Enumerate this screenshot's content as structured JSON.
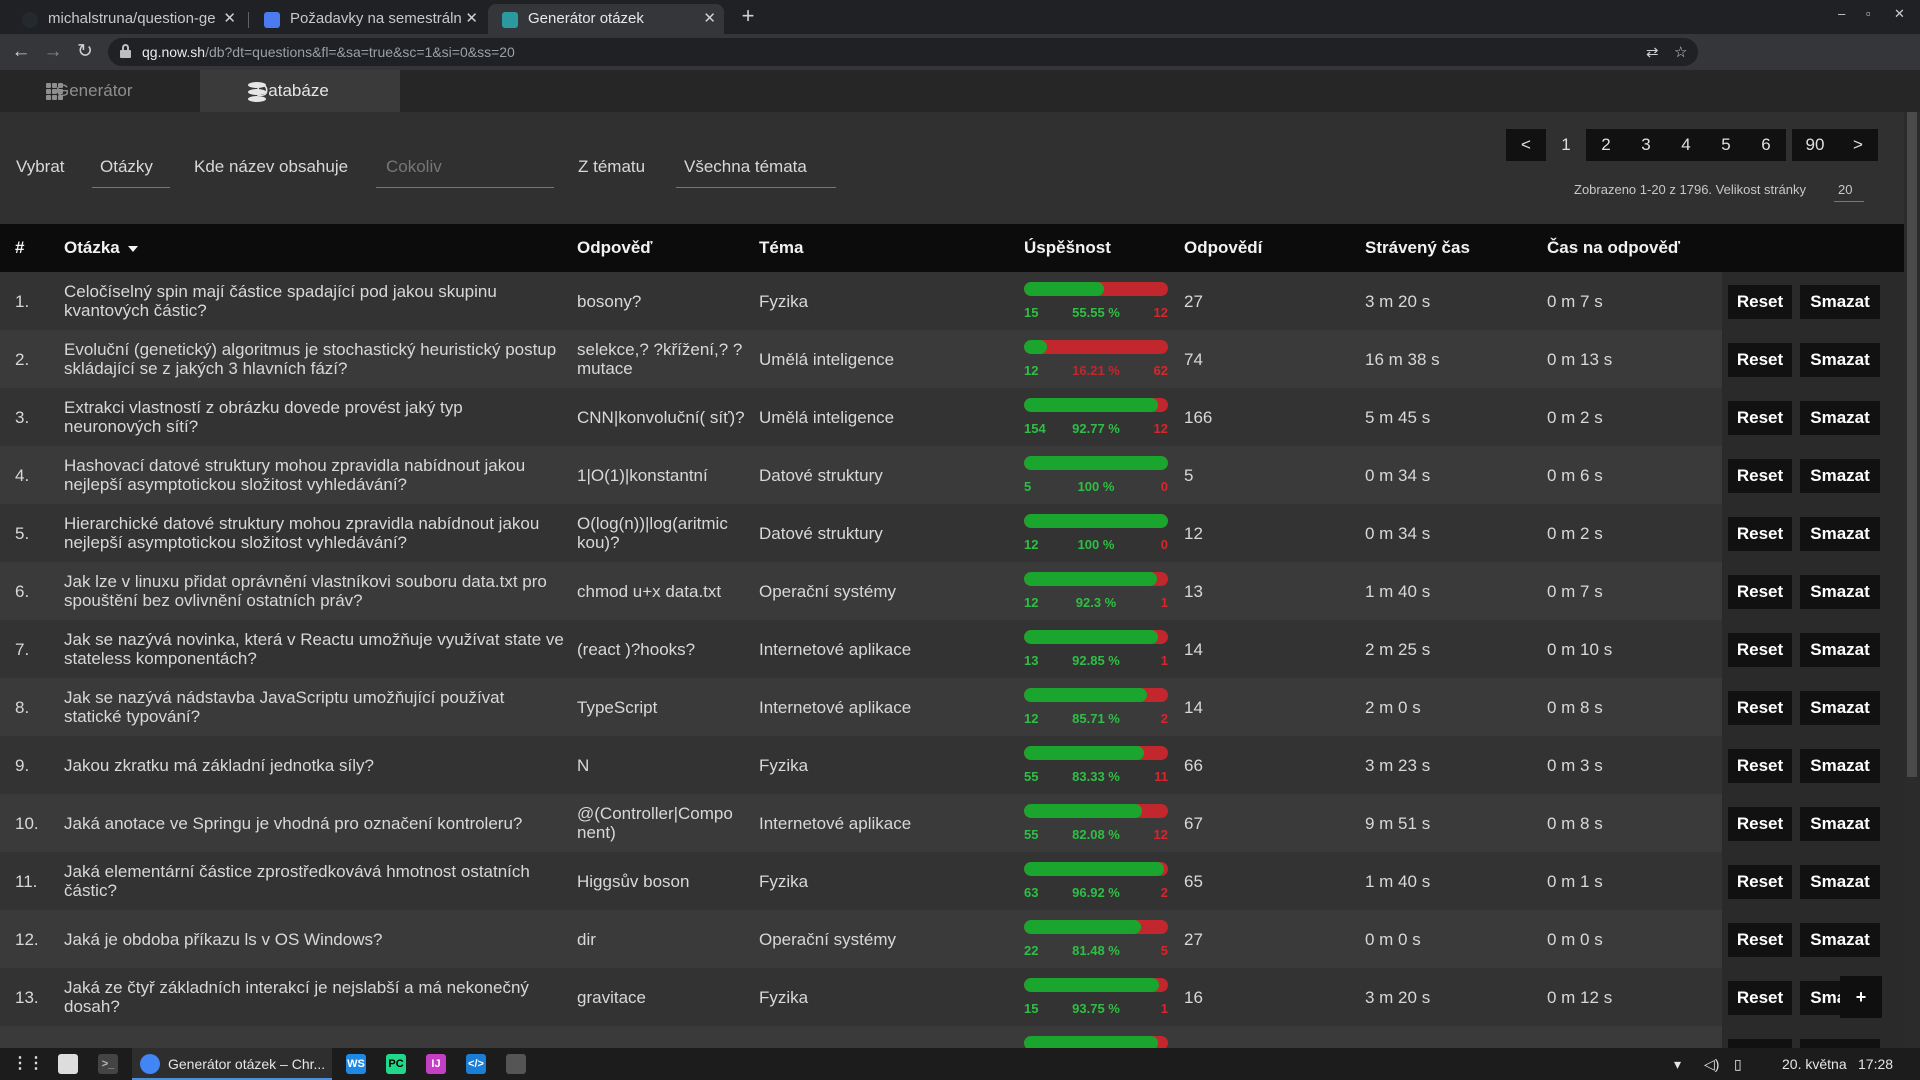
{
  "browser": {
    "tabs": [
      {
        "title": "michalstruna/question-ge",
        "icon_color": "#24292e"
      },
      {
        "title": "Požadavky na semestráln",
        "icon_color": "#4a7bf0"
      },
      {
        "title": "Generátor otázek",
        "icon_color": "#2a9aa0"
      }
    ],
    "url_host": "qg.now.sh",
    "url_path": "/db?dt=questions&fl=&sa=true&sc=1&si=0&ss=20"
  },
  "app_nav": {
    "generator_label": "Generátor",
    "database_label": "Databáze"
  },
  "filter": {
    "select_label": "Vybrat",
    "entity_value": "Otázky",
    "name_contains_label": "Kde název obsahuje",
    "search_placeholder": "Cokoliv",
    "topic_label": "Z tématu",
    "topic_value": "Všechna témata"
  },
  "pagination": {
    "prev": "<",
    "pages": [
      "1",
      "2",
      "3",
      "4",
      "5",
      "6",
      "90"
    ],
    "next": ">",
    "info": "Zobrazeno 1-20 z 1796. Velikost stránky",
    "page_size": "20"
  },
  "table": {
    "headers": {
      "idx": "#",
      "question": "Otázka",
      "answer": "Odpověď",
      "topic": "Téma",
      "success": "Úspěšnost",
      "answers": "Odpovědí",
      "time_spent": "Strávený čas",
      "time_per_answer": "Čas na odpověď"
    },
    "reset_label": "Reset",
    "delete_label": "Smazat",
    "rows": [
      {
        "idx": "1.",
        "q": "Celočíselný spin mají částice spadající pod jakou skupinu kvantových částic?",
        "a": "bosony?",
        "topic": "Fyzika",
        "ok": "15",
        "pct": "55.55 %",
        "bad": "12",
        "rate": 0.5555,
        "n": "27",
        "spent": "3 m 20 s",
        "per": "0 m 7 s"
      },
      {
        "idx": "2.",
        "q": "Evoluční (genetický) algoritmus je stochastický heuristický postup skládající se z jakých 3 hlavních fází?",
        "a": "selekce,? ?křížení,? ?mutace",
        "topic": "Umělá inteligence",
        "ok": "12",
        "pct": "16.21 %",
        "bad": "62",
        "rate": 0.1621,
        "n": "74",
        "spent": "16 m 38 s",
        "per": "0 m 13 s"
      },
      {
        "idx": "3.",
        "q": "Extrakci vlastností z obrázku dovede provést jaký typ neuronových sítí?",
        "a": "CNN|konvoluční( síť)?",
        "topic": "Umělá inteligence",
        "ok": "154",
        "pct": "92.77 %",
        "bad": "12",
        "rate": 0.9277,
        "n": "166",
        "spent": "5 m 45 s",
        "per": "0 m 2 s"
      },
      {
        "idx": "4.",
        "q": "Hashovací datové struktury mohou zpravidla nabídnout jakou nejlepší asymptotickou složitost vyhledávání?",
        "a": "1|O(1)|konstantní",
        "topic": "Datové struktury",
        "ok": "5",
        "pct": "100 %",
        "bad": "0",
        "rate": 1.0,
        "n": "5",
        "spent": "0 m 34 s",
        "per": "0 m 6 s"
      },
      {
        "idx": "5.",
        "q": "Hierarchické datové struktury mohou zpravidla nabídnout jakou nejlepší asymptotickou složitost vyhledávání?",
        "a": "O(log(n))|log(aritmic kou)?",
        "topic": "Datové struktury",
        "ok": "12",
        "pct": "100 %",
        "bad": "0",
        "rate": 1.0,
        "n": "12",
        "spent": "0 m 34 s",
        "per": "0 m 2 s"
      },
      {
        "idx": "6.",
        "q": "Jak lze v linuxu přidat oprávnění vlastníkovi souboru data.txt pro spouštění bez ovlivnění ostatních práv?",
        "a": "chmod u+x data.txt",
        "topic": "Operační systémy",
        "ok": "12",
        "pct": "92.3 %",
        "bad": "1",
        "rate": 0.923,
        "n": "13",
        "spent": "1 m 40 s",
        "per": "0 m 7 s"
      },
      {
        "idx": "7.",
        "q": "Jak se nazývá novinka, která v Reactu umožňuje využívat state ve stateless komponentách?",
        "a": "(react )?hooks?",
        "topic": "Internetové aplikace",
        "ok": "13",
        "pct": "92.85 %",
        "bad": "1",
        "rate": 0.9285,
        "n": "14",
        "spent": "2 m 25 s",
        "per": "0 m 10 s"
      },
      {
        "idx": "8.",
        "q": "Jak se nazývá nádstavba JavaScriptu umožňující používat statické typování?",
        "a": "TypeScript",
        "topic": "Internetové aplikace",
        "ok": "12",
        "pct": "85.71 %",
        "bad": "2",
        "rate": 0.8571,
        "n": "14",
        "spent": "2 m 0 s",
        "per": "0 m 8 s"
      },
      {
        "idx": "9.",
        "q": "Jakou zkratku má základní jednotka síly?",
        "a": "N",
        "topic": "Fyzika",
        "ok": "55",
        "pct": "83.33 %",
        "bad": "11",
        "rate": 0.8333,
        "n": "66",
        "spent": "3 m 23 s",
        "per": "0 m 3 s"
      },
      {
        "idx": "10.",
        "q": "Jaká anotace ve Springu je vhodná pro označení kontroleru?",
        "a": "@(Controller|Compo nent)",
        "topic": "Internetové aplikace",
        "ok": "55",
        "pct": "82.08 %",
        "bad": "12",
        "rate": 0.8208,
        "n": "67",
        "spent": "9 m 51 s",
        "per": "0 m 8 s"
      },
      {
        "idx": "11.",
        "q": "Jaká elementární částice zprostředkovává hmotnost ostatních částic?",
        "a": "Higgsův boson",
        "topic": "Fyzika",
        "ok": "63",
        "pct": "96.92 %",
        "bad": "2",
        "rate": 0.9692,
        "n": "65",
        "spent": "1 m 40 s",
        "per": "0 m 1 s"
      },
      {
        "idx": "12.",
        "q": "Jaká je obdoba příkazu ls v OS Windows?",
        "a": "dir",
        "topic": "Operační systémy",
        "ok": "22",
        "pct": "81.48 %",
        "bad": "5",
        "rate": 0.8148,
        "n": "27",
        "spent": "0 m 0 s",
        "per": "0 m 0 s"
      },
      {
        "idx": "13.",
        "q": "Jaká ze čtyř základních interakcí je nejslabší a má nekonečný dosah?",
        "a": "gravitace",
        "topic": "Fyzika",
        "ok": "15",
        "pct": "93.75 %",
        "bad": "1",
        "rate": 0.9375,
        "n": "16",
        "spent": "3 m 20 s",
        "per": "0 m 12 s"
      },
      {
        "idx": "",
        "q": "",
        "a": "",
        "topic": "",
        "ok": "",
        "pct": "",
        "bad": "",
        "rate": 0.93,
        "n": "",
        "spent": "",
        "per": ""
      }
    ]
  },
  "fab_label": "+",
  "taskbar": {
    "app_label": "Generátor otázek – Chr...",
    "date": "20. května",
    "time": "17:28"
  }
}
